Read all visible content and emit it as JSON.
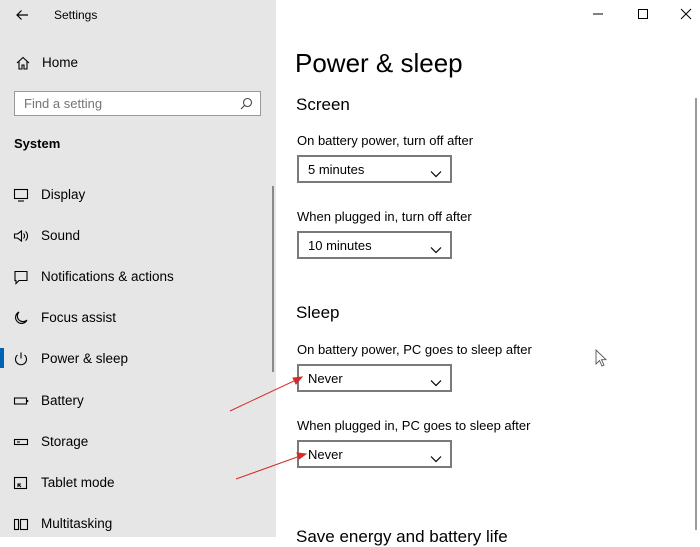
{
  "app": {
    "title": "Settings"
  },
  "sidebar": {
    "home_label": "Home",
    "search_placeholder": "Find a setting",
    "section_label": "System",
    "items": [
      {
        "label": "Display",
        "icon": "display-icon"
      },
      {
        "label": "Sound",
        "icon": "sound-icon"
      },
      {
        "label": "Notifications & actions",
        "icon": "notifications-icon"
      },
      {
        "label": "Focus assist",
        "icon": "moon-icon"
      },
      {
        "label": "Power & sleep",
        "icon": "power-icon",
        "active": true
      },
      {
        "label": "Battery",
        "icon": "battery-icon"
      },
      {
        "label": "Storage",
        "icon": "storage-icon"
      },
      {
        "label": "Tablet mode",
        "icon": "tablet-mode-icon"
      },
      {
        "label": "Multitasking",
        "icon": "multitasking-icon"
      }
    ]
  },
  "main": {
    "page_title": "Power & sleep",
    "screen": {
      "title": "Screen",
      "battery_label": "On battery power, turn off after",
      "battery_value": "5 minutes",
      "plugged_label": "When plugged in, turn off after",
      "plugged_value": "10 minutes"
    },
    "sleep": {
      "title": "Sleep",
      "battery_label": "On battery power, PC goes to sleep after",
      "battery_value": "Never",
      "plugged_label": "When plugged in, PC goes to sleep after",
      "plugged_value": "Never"
    },
    "next_section_title": "Save energy and battery life"
  },
  "colors": {
    "sidebar_bg": "#e6e6e6",
    "accent": "#0063b1",
    "annotation_arrow": "#d42a2a"
  }
}
